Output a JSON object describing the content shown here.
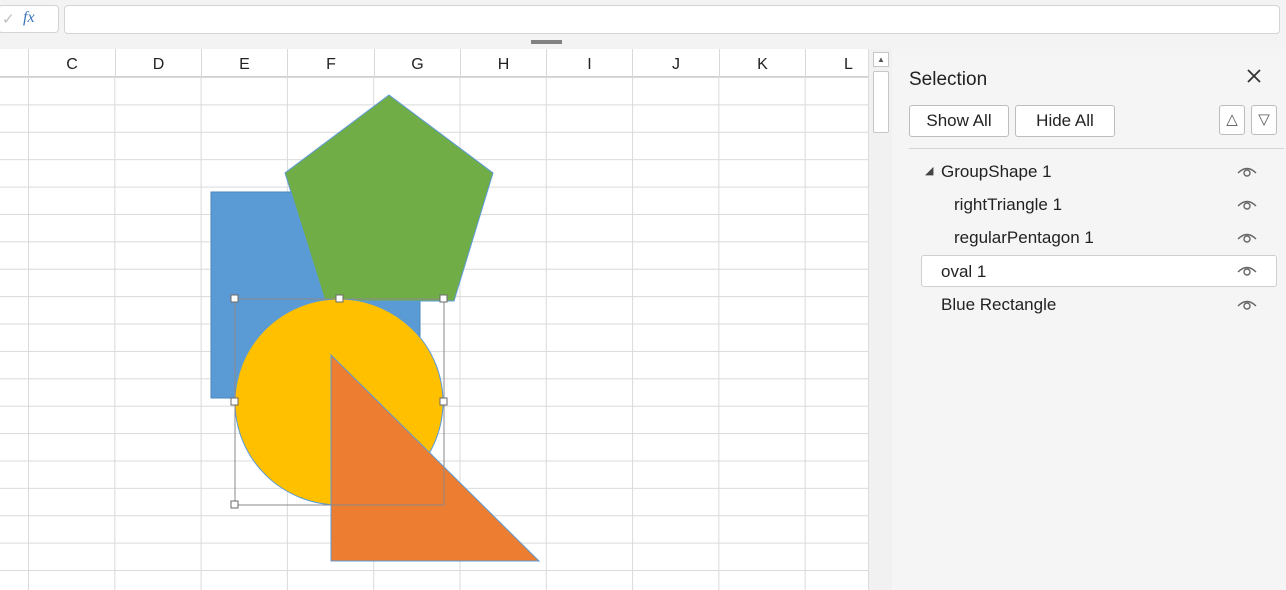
{
  "formula_bar": {
    "fx_label": "fx",
    "check_symbol": "✓",
    "input_value": ""
  },
  "sheet": {
    "columns": [
      "C",
      "D",
      "E",
      "F",
      "G",
      "H",
      "I",
      "J",
      "K",
      "L"
    ],
    "shapes": [
      {
        "name": "Blue Rectangle",
        "type": "rectangle",
        "color": "#5b9bd5"
      },
      {
        "name": "oval 1",
        "type": "oval",
        "color": "#ffc000",
        "selected": true
      },
      {
        "name": "regularPentagon 1",
        "type": "pentagon",
        "color": "#70ad47"
      },
      {
        "name": "rightTriangle 1",
        "type": "right-triangle",
        "color": "#ed7d31"
      }
    ]
  },
  "selection_pane": {
    "title": "Selection",
    "close_icon": "close-icon",
    "show_all_label": "Show All",
    "hide_all_label": "Hide All",
    "move_up_symbol": "△",
    "move_down_symbol": "▽",
    "items": [
      {
        "label": "GroupShape 1",
        "level": 0,
        "expandable": true,
        "expanded": true,
        "visible": true
      },
      {
        "label": "rightTriangle 1",
        "level": 1,
        "visible": true
      },
      {
        "label": "regularPentagon 1",
        "level": 1,
        "visible": true
      },
      {
        "label": "oval 1",
        "level": 0,
        "selected": true,
        "visible": true
      },
      {
        "label": "Blue Rectangle",
        "level": 0,
        "visible": true
      }
    ]
  },
  "colors": {
    "accent_fx": "#3b73b9",
    "grid_line": "#dadada",
    "pane_background": "#f5f5f5"
  }
}
